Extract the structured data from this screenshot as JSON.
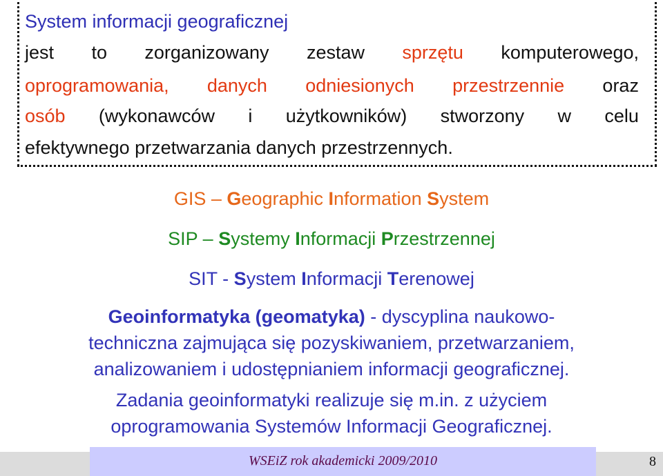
{
  "definition": {
    "title": "System informacji geograficznej",
    "line1": [
      {
        "text": "jest",
        "color": "black"
      },
      {
        "text": "to",
        "color": "black"
      },
      {
        "text": "zorganizowany",
        "color": "black"
      },
      {
        "text": "zestaw",
        "color": "black"
      },
      {
        "text": "sprzętu",
        "color": "red"
      },
      {
        "text": "komputerowego,",
        "color": "black"
      }
    ],
    "line2": [
      {
        "text": "oprogramowania,",
        "color": "red"
      },
      {
        "text": "danych",
        "color": "red"
      },
      {
        "text": "odniesionych",
        "color": "red"
      },
      {
        "text": "przestrzennie",
        "color": "red"
      },
      {
        "text": "oraz",
        "color": "black"
      }
    ],
    "line3": [
      {
        "text": "osób",
        "color": "red"
      },
      {
        "text": "(wykonawców",
        "color": "black"
      },
      {
        "text": "i",
        "color": "black"
      },
      {
        "text": "użytkowników)",
        "color": "black"
      },
      {
        "text": "stworzony",
        "color": "black"
      },
      {
        "text": "w",
        "color": "black"
      },
      {
        "text": "celu",
        "color": "black"
      }
    ],
    "line4": "efektywnego przetwarzania danych przestrzennych."
  },
  "acronyms": {
    "gis": {
      "abbr": "GIS",
      "sep": " – ",
      "parts": [
        [
          "G",
          "eographic "
        ],
        [
          "I",
          "nformation "
        ],
        [
          "S",
          "ystem"
        ]
      ]
    },
    "sip": {
      "abbr": "SIP",
      "sep": " – ",
      "parts": [
        [
          "S",
          "ystemy "
        ],
        [
          "I",
          "nformacji "
        ],
        [
          "P",
          "rzestrzennej"
        ]
      ]
    },
    "sit": {
      "abbr": "SIT",
      "sep": " - ",
      "parts": [
        [
          "S",
          "ystem "
        ],
        [
          "I",
          "nformacji "
        ],
        [
          "T",
          "erenowej"
        ]
      ]
    }
  },
  "geoinformatics": {
    "term": "Geoinformatyka (geomatyka)",
    "line1_rest": " - dyscyplina naukowo-",
    "line2": "techniczna zajmująca się pozyskiwaniem, przetwarzaniem,",
    "line3": "analizowaniem i udostępnianiem informacji geograficznej.",
    "line4": "Zadania geoinformatyki realizuje się m.in. z użyciem",
    "line5": "oprogramowania Systemów Informacji Geograficznej."
  },
  "footer": {
    "text": "WSEiZ rok akademicki 2009/2010",
    "page_number": "8"
  },
  "colors": {
    "black": "#111111",
    "red": "#e23a12",
    "blue": "#2e2fb5",
    "orange": "#e6671a",
    "green": "#1e8a22",
    "navy": "#3233b8",
    "footer_box": "#ccccff",
    "footer_text": "#5b0a4a"
  }
}
